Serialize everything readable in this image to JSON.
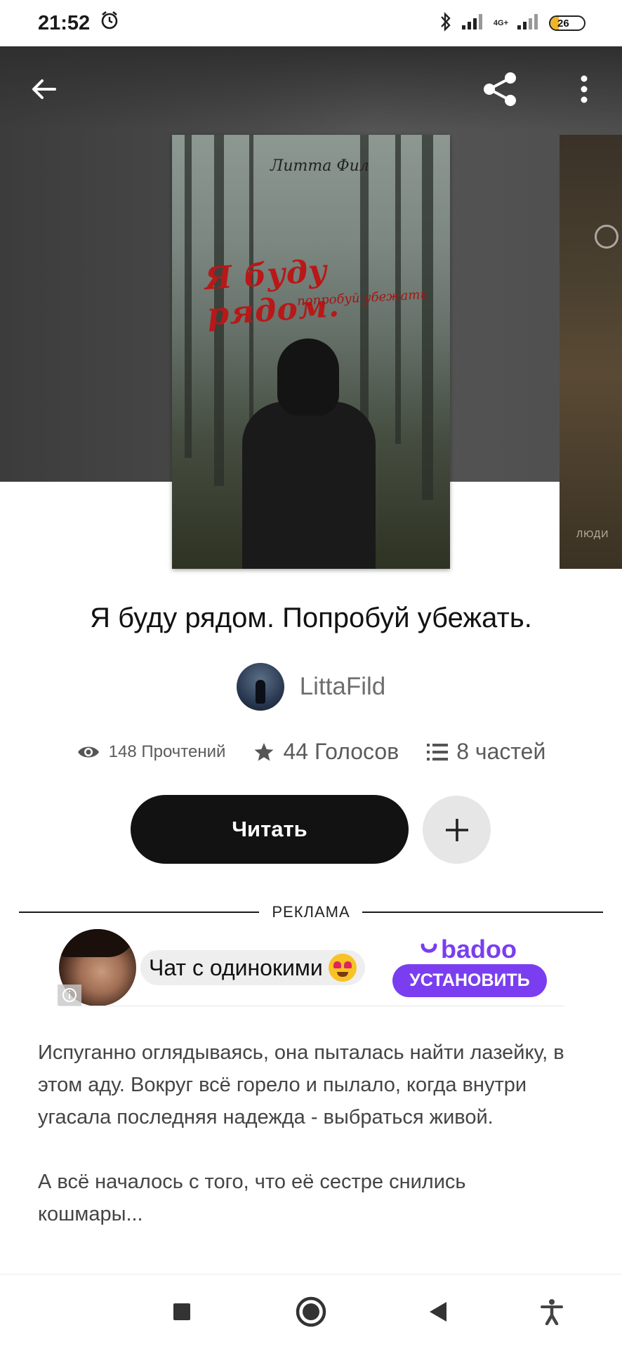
{
  "status_bar": {
    "time": "21:52",
    "network": "4G+",
    "battery": "26",
    "battery_level": 0.26
  },
  "header": {
    "back_icon": "arrow-left-icon",
    "share_icon": "share-icon",
    "more_icon": "more-vertical-icon"
  },
  "cover": {
    "author_script": "Литта Фил",
    "title": "Я буду рядом.",
    "subtitle": "попробуй убежать",
    "next_cover_text": "ЛЮДИ"
  },
  "story": {
    "title": "Я буду рядом. Попробуй убежать.",
    "author": "LittaFild",
    "reads": "148 Прочтений",
    "votes": "44 Голосов",
    "parts": "8 частей",
    "read_button": "Читать"
  },
  "ad": {
    "label": "РЕКЛАМА",
    "text": "Чат с одинокими",
    "brand": "badoo",
    "install": "УСТАНОВИТЬ",
    "brand_color": "#7a3ef0"
  },
  "description": {
    "paragraph1": "Испуганно оглядываясь, она пыталась найти лазейку, в этом аду. Вокруг всё горело и пылало, когда внутри угасала последняя надежда - выбраться живой.",
    "paragraph2": "А всё началось с того, что её сестре снились кошмары..."
  },
  "navbar": {
    "recents_icon": "square-icon",
    "home_icon": "circle-icon",
    "back_icon": "triangle-back-icon",
    "accessibility_icon": "accessibility-icon"
  }
}
